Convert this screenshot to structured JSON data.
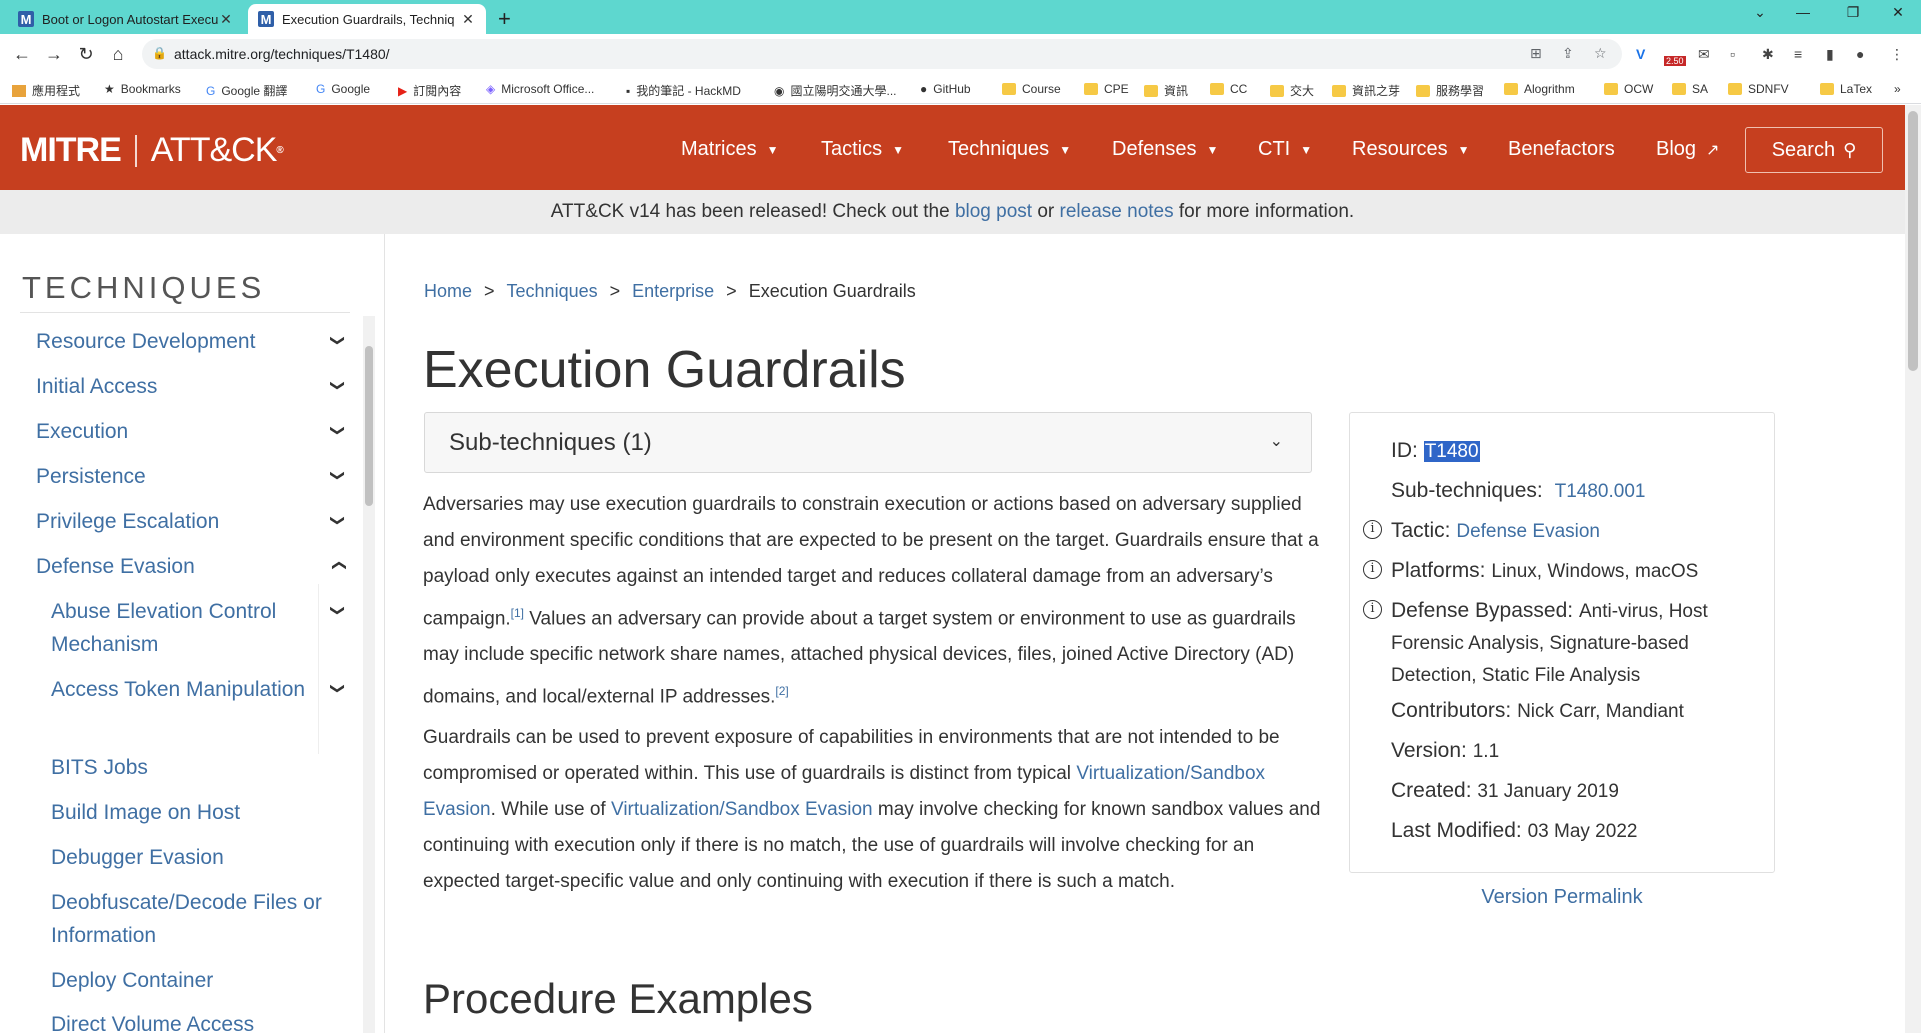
{
  "browser": {
    "tabs": [
      {
        "label": "Boot or Logon Autostart Execu"
      },
      {
        "label": "Execution Guardrails, Techniq"
      }
    ],
    "url": "attack.mitre.org/techniques/T1480/",
    "ext_badge": "2.50",
    "bookmarks": [
      "應用程式",
      "Bookmarks",
      "Google 翻譯",
      "Google",
      "訂閱內容",
      "Microsoft Office...",
      "我的筆記 - HackMD",
      "國立陽明交通大學...",
      "GitHub",
      "Course",
      "CPE",
      "資訊",
      "CC",
      "交大",
      "資訊之芽",
      "服務學習",
      "Alogrithm",
      "OCW",
      "SA",
      "SDNFV",
      "LaTex"
    ]
  },
  "header": {
    "logo_left": "MITRE",
    "logo_right": "ATT&CK",
    "logo_reg": "®",
    "nav": [
      "Matrices",
      "Tactics",
      "Techniques",
      "Defenses",
      "CTI",
      "Resources",
      "Benefactors",
      "Blog"
    ],
    "search": "Search"
  },
  "banner": {
    "pre": "ATT&CK v14 has been released! Check out the ",
    "link1": "blog post",
    "mid": " or ",
    "link2": "release notes",
    "post": " for more information."
  },
  "sidebar": {
    "title": "TECHNIQUES",
    "items": [
      "Resource Development",
      "Initial Access",
      "Execution",
      "Persistence",
      "Privilege Escalation",
      "Defense Evasion",
      "Abuse Elevation Control Mechanism",
      "Access Token Manipulation",
      "BITS Jobs",
      "Build Image on Host",
      "Debugger Evasion",
      "Deobfuscate/Decode Files or Information",
      "Deploy Container",
      "Direct Volume Access"
    ]
  },
  "breadcrumb": [
    "Home",
    "Techniques",
    "Enterprise",
    "Execution Guardrails"
  ],
  "page": {
    "title": "Execution Guardrails",
    "subtechniques_label": "Sub-techniques (1)",
    "p1a": "Adversaries may use execution guardrails to constrain execution or actions based on adversary supplied and environment specific conditions that are expected to be present on the target. Guardrails ensure that a payload only executes against an intended target and reduces collateral damage from an adversary’s campaign.",
    "ref1": "[1]",
    "p1b": " Values an adversary can provide about a target system or environment to use as guardrails may include specific network share names, attached physical devices, files, joined Active Directory (AD) domains, and local/external IP addresses.",
    "ref2": "[2]",
    "p2a": "Guardrails can be used to prevent exposure of capabilities in environments that are not intended to be compromised or operated within. This use of guardrails is distinct from typical ",
    "p2link1": "Virtualization/Sandbox Evasion",
    "p2b": ". While use of ",
    "p2link2": "Virtualization/Sandbox Evasion",
    "p2c": " may involve checking for known sandbox values and continuing with execution only if there is no match, the use of guardrails will involve checking for an expected target-specific value and only continuing with execution if there is such a match.",
    "section": "Procedure Examples"
  },
  "card": {
    "id_label": "ID:",
    "id_value": "T1480",
    "sub_label": "Sub-techniques:",
    "sub_value": "T1480.001",
    "tactic_label": "Tactic:",
    "tactic_value": "Defense Evasion",
    "platforms_label": "Platforms:",
    "platforms_value": "Linux, Windows, macOS",
    "bypassed_label": "Defense Bypassed:",
    "bypassed_value": "Anti-virus, Host Forensic Analysis, Signature-based Detection, Static File Analysis",
    "contrib_label": "Contributors:",
    "contrib_value": "Nick Carr, Mandiant",
    "version_label": "Version:",
    "version_value": "1.1",
    "created_label": "Created:",
    "created_value": "31 January 2019",
    "modified_label": "Last Modified:",
    "modified_value": "03 May 2022",
    "permalink": "Version Permalink"
  }
}
